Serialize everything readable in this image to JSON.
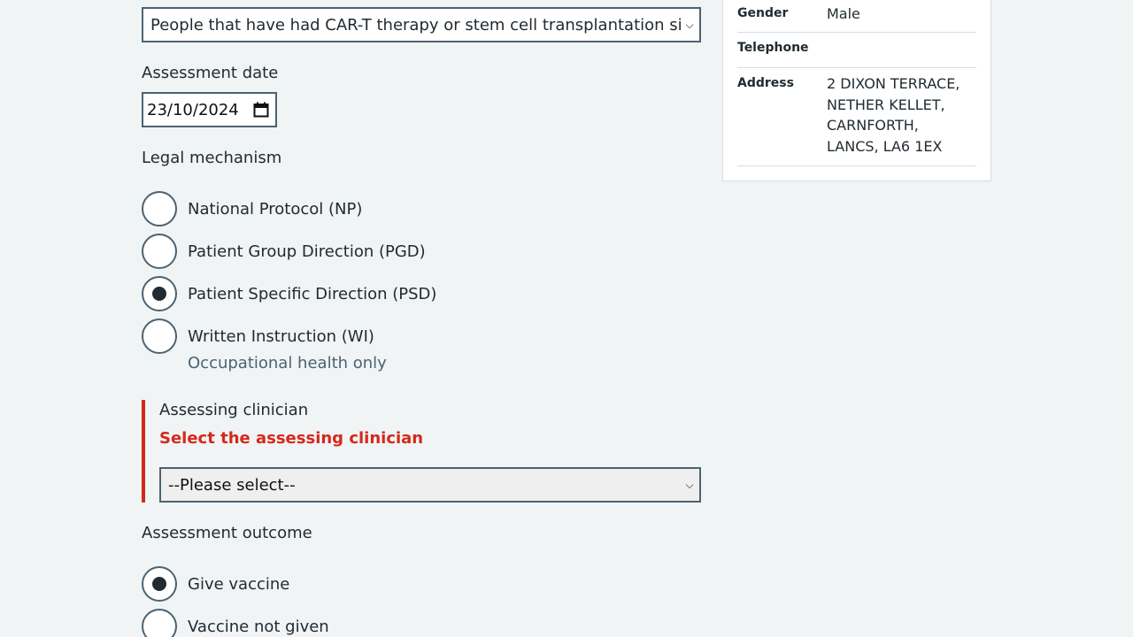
{
  "eligibility": {
    "selected": "People that have had CAR-T therapy or stem cell transplantation since their last dose"
  },
  "assessment_date": {
    "label": "Assessment date",
    "value": "23/10/2024"
  },
  "legal_mechanism": {
    "label": "Legal mechanism",
    "options": [
      {
        "label": "National Protocol (NP)",
        "checked": false
      },
      {
        "label": "Patient Group Direction (PGD)",
        "checked": false
      },
      {
        "label": "Patient Specific Direction (PSD)",
        "checked": true
      },
      {
        "label": "Written Instruction (WI)",
        "checked": false,
        "hint": "Occupational health only"
      }
    ]
  },
  "assessing_clinician": {
    "label": "Assessing clinician",
    "error": "Select the assessing clinician",
    "selected": "--Please select--"
  },
  "assessment_outcome": {
    "label": "Assessment outcome",
    "options": [
      {
        "label": "Give vaccine",
        "checked": true
      },
      {
        "label": "Vaccine not given",
        "checked": false
      }
    ]
  },
  "patient_details": {
    "rows": [
      {
        "key": "Gender",
        "value": "Male"
      },
      {
        "key": "Telephone",
        "value": ""
      },
      {
        "key": "Address",
        "lines": [
          "2 DIXON TERRACE,",
          "NETHER KELLET,",
          "CARNFORTH,",
          "LANCS, LA6 1EX"
        ]
      }
    ]
  },
  "colors": {
    "background": "#f0f4f5",
    "text": "#212b32",
    "error": "#d5281b",
    "border": "#4c6272",
    "hint": "#4c6272"
  },
  "icons": {
    "select_arrow": "chevron-down-icon",
    "date_picker": "calendar-icon"
  }
}
